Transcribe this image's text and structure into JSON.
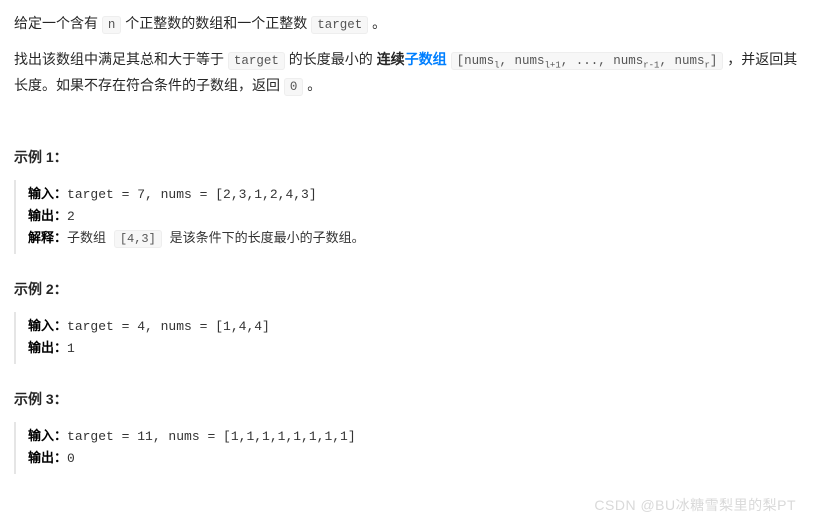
{
  "intro": {
    "p1a": "给定一个含有 ",
    "n": "n",
    "p1b": " 个正整数的数组和一个正整数 ",
    "target": "target",
    "p1c": " 。",
    "p2a": "找出该数组中满足其总和大于等于 ",
    "p2b": " 的长度最小的 ",
    "bold": "连续",
    "link": "子数组",
    "p2c": " ",
    "arr": "[numsₗ, numsₗ₊₁, ..., numsᵣ₋₁, numsᵣ]",
    "p2d": " ，并返回其长度。如果不存在符合条件的子数组，返回 ",
    "zero": "0",
    "p2e": " 。"
  },
  "labels": {
    "input": "输入：",
    "output": "输出：",
    "explain": "解释："
  },
  "examples": [
    {
      "title": "示例 1：",
      "input": "target = 7, nums = [2,3,1,2,4,3]",
      "output": "2",
      "explain_a": "子数组 ",
      "explain_code": "[4,3]",
      "explain_b": " 是该条件下的长度最小的子数组。"
    },
    {
      "title": "示例 2：",
      "input": "target = 4, nums = [1,4,4]",
      "output": "1"
    },
    {
      "title": "示例 3：",
      "input": "target = 11, nums = [1,1,1,1,1,1,1,1]",
      "output": "0"
    }
  ],
  "watermark": "CSDN @BU冰糖雪梨里的梨PT"
}
